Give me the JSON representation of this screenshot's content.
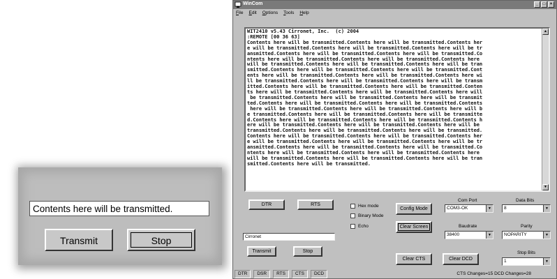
{
  "zoom": {
    "input_value": "Contents here will be transmitted.",
    "transmit_label": "Transmit",
    "stop_label": "Stop"
  },
  "window": {
    "title": "WinCom",
    "menu": [
      "File",
      "Edit",
      "Options",
      "Tools",
      "Help"
    ],
    "terminal_lines": [
      "WIT2410 v5.43 Cirronet, Inc.  (c) 2004",
      ":REMOTE [00 36 63]",
      "Contents here will be transmitted.Contents here will be transmitted.Contents her",
      "e will be transmitted.Contents here will be transmitted.Contents here will be tr",
      "ansmitted.Contents here will be transmitted.Contents here will be transmitted.Co",
      "ntents here will be transmitted.Contents here will be transmitted.Contents here",
      "will be transmitted.Contents here will be transmitted.Contents here will be tran",
      "smitted.Contents here will be transmitted.Contents here will be transmitted.Cont",
      "ents here will be transmitted.Contents here will be transmitted.Contents here wi",
      "ll be transmitted.Contents here will be transmitted.Contents here will be transm",
      "itted.Contents here will be transmitted.Contents here will be transmitted.Conten",
      "ts here will be transmitted.Contents here will be transmitted.Contents here will",
      " be transmitted.Contents here will be transmitted.Contents here will be transmit",
      "ted.Contents here will be transmitted.Contents here will be transmitted.Contents",
      " here will be transmitted.Contents here will be transmitted.Contents here will b",
      "e transmitted.Contents here will be transmitted.Contents here will be transmitte",
      "d.Contents here will be transmitted.Contents here will be transmitted.Contents h",
      "ere will be transmitted.Contents here will be transmitted.Contents here will be",
      "transmitted.Contents here will be transmitted.Contents here will be transmitted.",
      "Contents here will be transmitted.Contents here will be transmitted.Contents her",
      "e will be transmitted.Contents here will be transmitted.Contents here will be tr",
      "ansmitted.Contents here will be transmitted.Contents here will be transmitted.Co",
      "ntents here will be transmitted.Contents here will be transmitted.Contents here",
      "will be transmitted.Contents here will be transmitted.Contents here will be tran",
      "smitted.Contents here will be transmitted."
    ],
    "dtr_label": "DTR",
    "rts_label": "RTS",
    "hex_mode_label": "Hex mode",
    "binary_mode_label": "Binary Mode",
    "echo_label": "Echo",
    "config_mode_label": "Config Mode",
    "clear_screen_label": "Clear Screen",
    "clear_cts_label": "Clear CTS",
    "clear_dcd_label": "Clear DCD",
    "send_field_value": "Cirronet",
    "transmit_label": "Transmit",
    "stop_label": "Stop",
    "com_port_label": "Com Port",
    "com_port_value": "COM3-OK",
    "data_bits_label": "Data Bits",
    "data_bits_value": "8",
    "baudrate_label": "Baudrate",
    "baudrate_value": "38400",
    "parity_label": "Parity",
    "parity_value": "NOPARITY",
    "stop_bits_label": "Stop Bits",
    "stop_bits_value": "1",
    "status": [
      "DTR",
      "DSR",
      "RTS",
      "CTS",
      "DCD"
    ],
    "status_right": "CTS Changes=15   DCD Changes=28"
  }
}
